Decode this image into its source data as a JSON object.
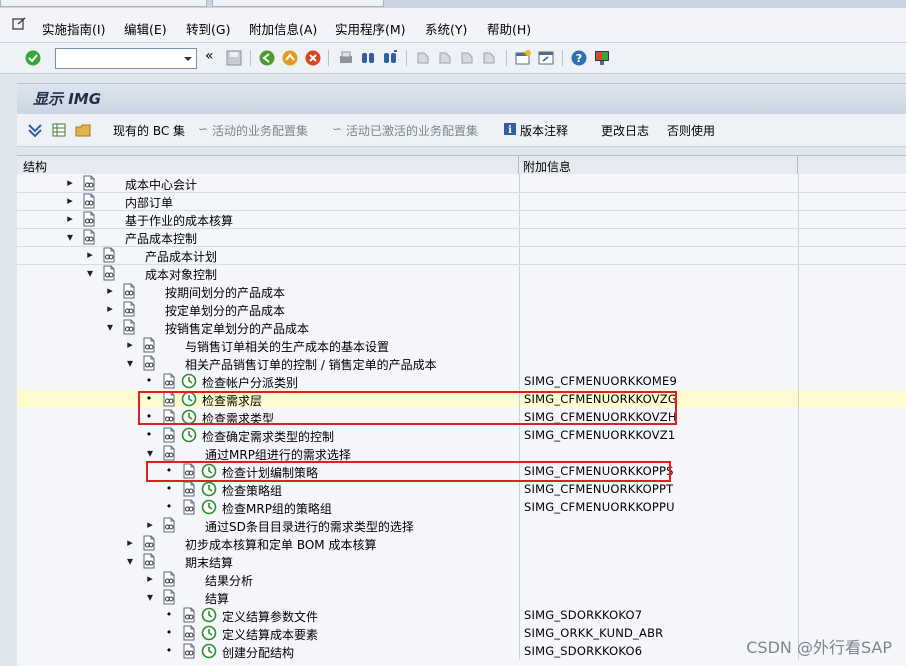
{
  "menu": [
    {
      "label": "实施指南(I)"
    },
    {
      "label": "编辑(E)"
    },
    {
      "label": "转到(G)"
    },
    {
      "label": "附加信息(A)"
    },
    {
      "label": "实用程序(M)"
    },
    {
      "label": "系统(Y)"
    },
    {
      "label": "帮助(H)"
    }
  ],
  "title": "显示 IMG",
  "app_toolbar": {
    "bc_sets": "现有的 BC 集",
    "active_bus": "活动的业务配置集",
    "activated_bus": "活动已激活的业务配置集",
    "release_notes": "版本注释",
    "change_log": "更改日志",
    "usage": "否则使用"
  },
  "columns": {
    "structure": "结构",
    "additional_info": "附加信息"
  },
  "tree": [
    {
      "label": "成本中心会计",
      "info": "",
      "level": 0,
      "toggle": "collapsed"
    },
    {
      "label": "内部订单",
      "info": "",
      "level": 0,
      "toggle": "collapsed"
    },
    {
      "label": "基于作业的成本核算",
      "info": "",
      "level": 0,
      "toggle": "collapsed"
    },
    {
      "label": "产品成本控制",
      "info": "",
      "level": 0,
      "toggle": "expanded"
    },
    {
      "label": "产品成本计划",
      "info": "",
      "level": 1,
      "toggle": "collapsed"
    },
    {
      "label": "成本对象控制",
      "info": "",
      "level": 1,
      "toggle": "expanded"
    },
    {
      "label": "按期间划分的产品成本",
      "info": "",
      "level": 2,
      "toggle": "collapsed"
    },
    {
      "label": "按定单划分的产品成本",
      "info": "",
      "level": 2,
      "toggle": "collapsed"
    },
    {
      "label": "按销售定单划分的产品成本",
      "info": "",
      "level": 2,
      "toggle": "expanded"
    },
    {
      "label": "与销售订单相关的生产成本的基本设置",
      "info": "",
      "level": 3,
      "toggle": "collapsed"
    },
    {
      "label": "相关产品销售订单的控制 / 销售定单的产品成本",
      "info": "",
      "level": 3,
      "toggle": "expanded"
    },
    {
      "label": "检查帐户分派类别",
      "info": "SIMG_CFMENUORKKOME9",
      "level": 4,
      "toggle": "leaf",
      "selected": false
    },
    {
      "label": "检查需求层",
      "info": "SIMG_CFMENUORKKOVZG",
      "level": 4,
      "toggle": "leaf",
      "selected": true
    },
    {
      "label": "检查需求类型",
      "info": "SIMG_CFMENUORKKOVZH",
      "level": 4,
      "toggle": "leaf"
    },
    {
      "label": "检查确定需求类型的控制",
      "info": "SIMG_CFMENUORKKOVZ1",
      "level": 4,
      "toggle": "leaf"
    },
    {
      "label": "通过MRP组进行的需求选择",
      "info": "",
      "level": 4,
      "toggle": "expanded"
    },
    {
      "label": "检查计划编制策略",
      "info": "SIMG_CFMENUORKKOPPS",
      "level": 5,
      "toggle": "leaf"
    },
    {
      "label": "检查策略组",
      "info": "SIMG_CFMENUORKKOPPT",
      "level": 5,
      "toggle": "leaf"
    },
    {
      "label": "检查MRP组的策略组",
      "info": "SIMG_CFMENUORKKOPPU",
      "level": 5,
      "toggle": "leaf"
    },
    {
      "label": "通过SD条目目录进行的需求类型的选择",
      "info": "",
      "level": 4,
      "toggle": "collapsed"
    },
    {
      "label": "初步成本核算和定单 BOM 成本核算",
      "info": "",
      "level": 3,
      "toggle": "collapsed"
    },
    {
      "label": "期末结算",
      "info": "",
      "level": 3,
      "toggle": "expanded"
    },
    {
      "label": "结果分析",
      "info": "",
      "level": 4,
      "toggle": "collapsed"
    },
    {
      "label": "结算",
      "info": "",
      "level": 4,
      "toggle": "expanded"
    },
    {
      "label": "定义结算参数文件",
      "info": "SIMG_SDORKKOKO7",
      "level": 5,
      "toggle": "leaf"
    },
    {
      "label": "定义结算成本要素",
      "info": "SIMG_ORKK_KUND_ABR",
      "level": 5,
      "toggle": "leaf"
    },
    {
      "label": "创建分配结构",
      "info": "SIMG_SDORKKOKO6",
      "level": 5,
      "toggle": "leaf"
    }
  ],
  "watermark": "CSDN @外行看SAP",
  "colors": {
    "selected_row": "#fffbd0",
    "highlight_box": "#e02020",
    "title_text": "#1e2e44"
  }
}
